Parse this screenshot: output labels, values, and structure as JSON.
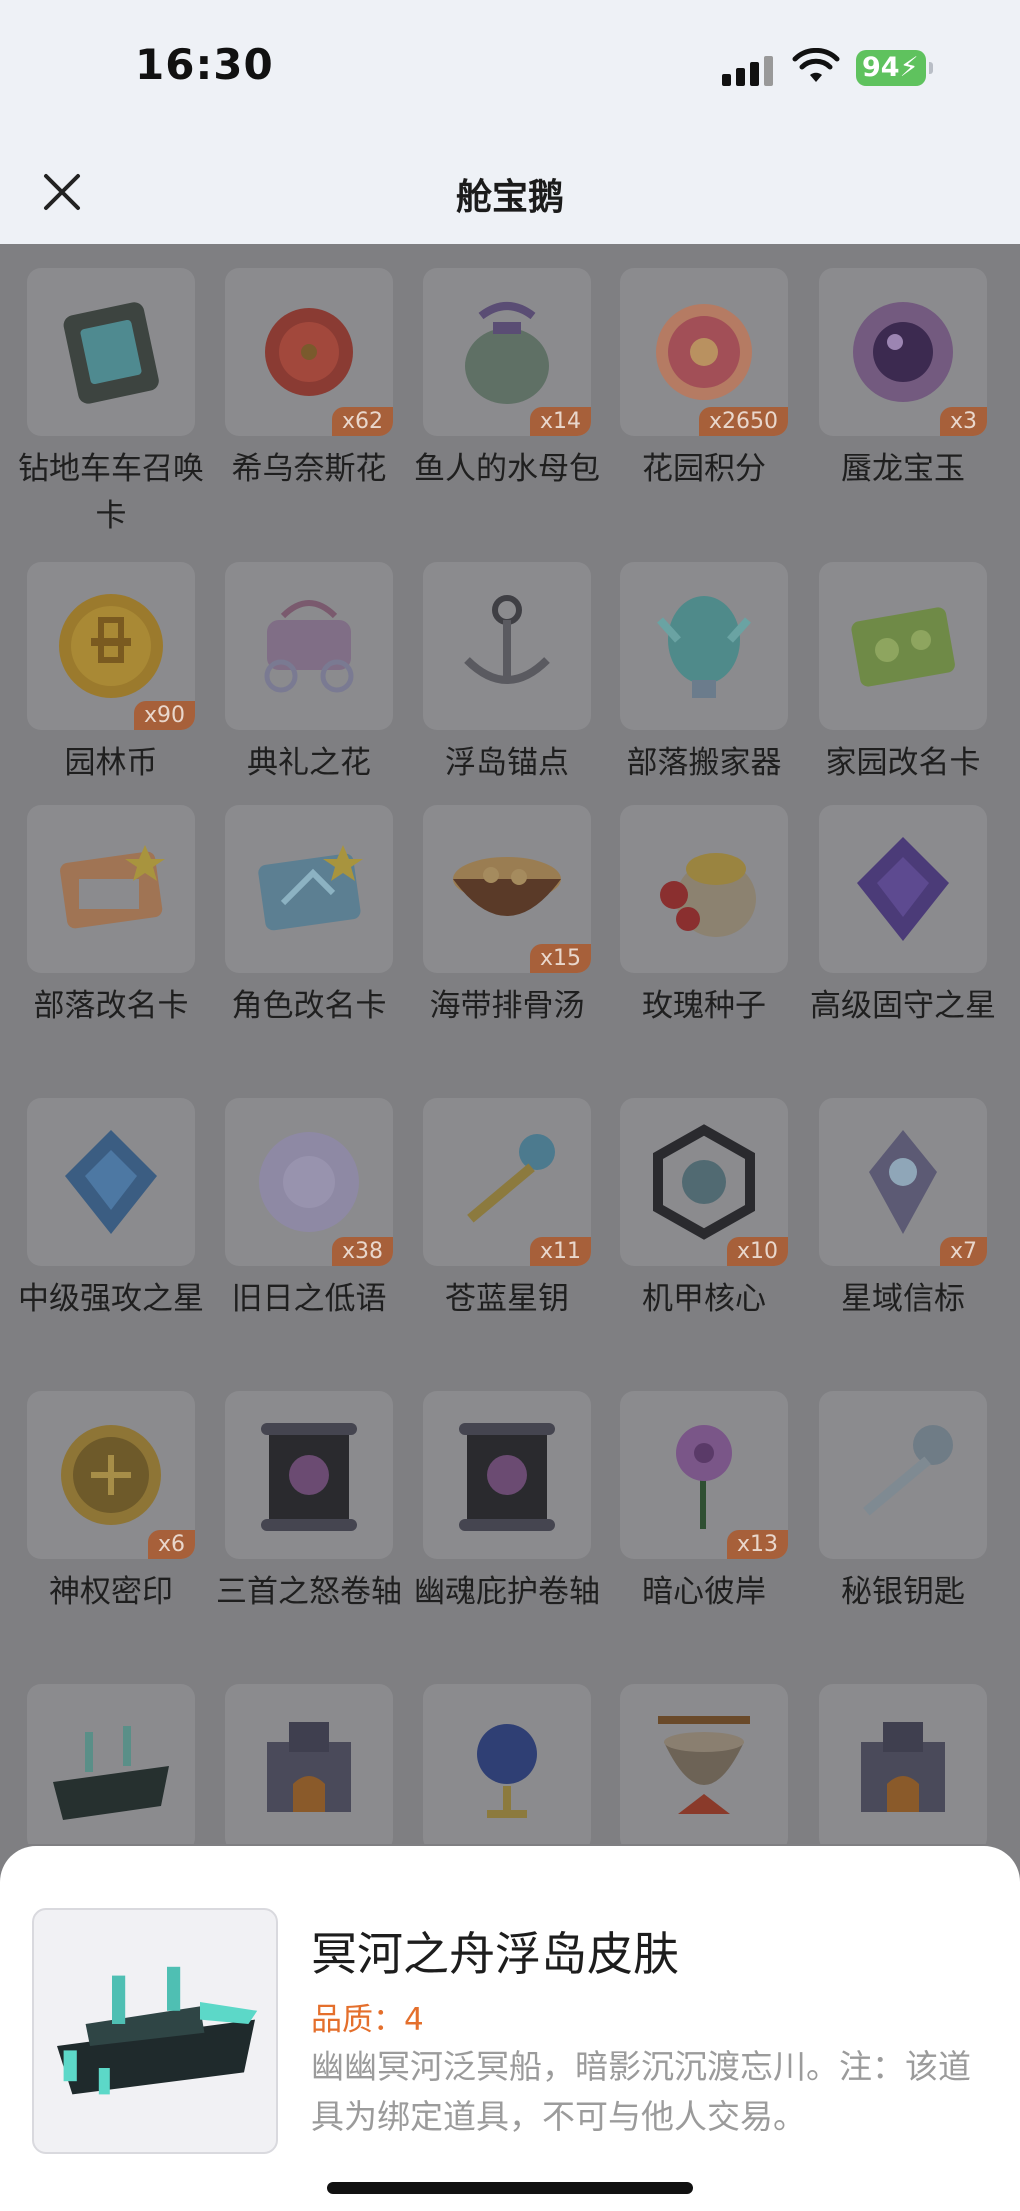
{
  "status_bar": {
    "time": "16:30",
    "battery": "94"
  },
  "nav": {
    "title": "舱宝鹅"
  },
  "items": [
    {
      "name": "钻地车车召唤卡",
      "count": "",
      "icon": "card-device-icon"
    },
    {
      "name": "希乌奈斯花",
      "count": "x62",
      "icon": "red-flower-icon"
    },
    {
      "name": "鱼人的水母包",
      "count": "x14",
      "icon": "pouch-icon"
    },
    {
      "name": "花园积分",
      "count": "x2650",
      "icon": "pink-flower-token-icon"
    },
    {
      "name": "蜃龙宝玉",
      "count": "x3",
      "icon": "purple-orb-icon"
    },
    {
      "name": "园林币",
      "count": "x90",
      "icon": "gold-coin-icon"
    },
    {
      "name": "典礼之花",
      "count": "",
      "icon": "carriage-icon"
    },
    {
      "name": "浮岛锚点",
      "count": "",
      "icon": "anchor-icon"
    },
    {
      "name": "部落搬家器",
      "count": "",
      "icon": "egg-crystal-icon"
    },
    {
      "name": "家园改名卡",
      "count": "",
      "icon": "green-card-icon"
    },
    {
      "name": "部落改名卡",
      "count": "",
      "icon": "orange-card-icon"
    },
    {
      "name": "角色改名卡",
      "count": "",
      "icon": "blue-card-icon"
    },
    {
      "name": "海带排骨汤",
      "count": "x15",
      "icon": "soup-bowl-icon"
    },
    {
      "name": "玫瑰种子",
      "count": "",
      "icon": "seed-sack-icon"
    },
    {
      "name": "高级固守之星",
      "count": "",
      "icon": "purple-gem-icon"
    },
    {
      "name": "中级强攻之星",
      "count": "",
      "icon": "blue-gem-icon"
    },
    {
      "name": "旧日之低语",
      "count": "x38",
      "icon": "bubble-orb-icon"
    },
    {
      "name": "苍蓝星钥",
      "count": "x11",
      "icon": "key-icon"
    },
    {
      "name": "机甲核心",
      "count": "x10",
      "icon": "mech-core-icon"
    },
    {
      "name": "星域信标",
      "count": "x7",
      "icon": "beacon-icon"
    },
    {
      "name": "神权密印",
      "count": "x6",
      "icon": "seal-coin-icon"
    },
    {
      "name": "三首之怒卷轴",
      "count": "",
      "icon": "scroll-icon"
    },
    {
      "name": "幽魂庇护卷轴",
      "count": "",
      "icon": "scroll-icon"
    },
    {
      "name": "暗心彼岸",
      "count": "x13",
      "icon": "lily-flower-icon"
    },
    {
      "name": "秘银钥匙",
      "count": "",
      "icon": "silver-key-icon"
    },
    {
      "name": "",
      "count": "",
      "icon": "ship-icon"
    },
    {
      "name": "",
      "count": "",
      "icon": "furnace-icon"
    },
    {
      "name": "",
      "count": "",
      "icon": "globe-stand-icon"
    },
    {
      "name": "",
      "count": "",
      "icon": "pot-icon"
    },
    {
      "name": "",
      "count": "",
      "icon": "furnace-icon"
    }
  ],
  "detail": {
    "title": "冥河之舟浮岛皮肤",
    "quality": "品质：4",
    "description": "幽幽冥河泛冥船，暗影沉沉渡忘川。注：该道具为绑定道具，不可与他人交易。",
    "icon": "ship-icon"
  }
}
